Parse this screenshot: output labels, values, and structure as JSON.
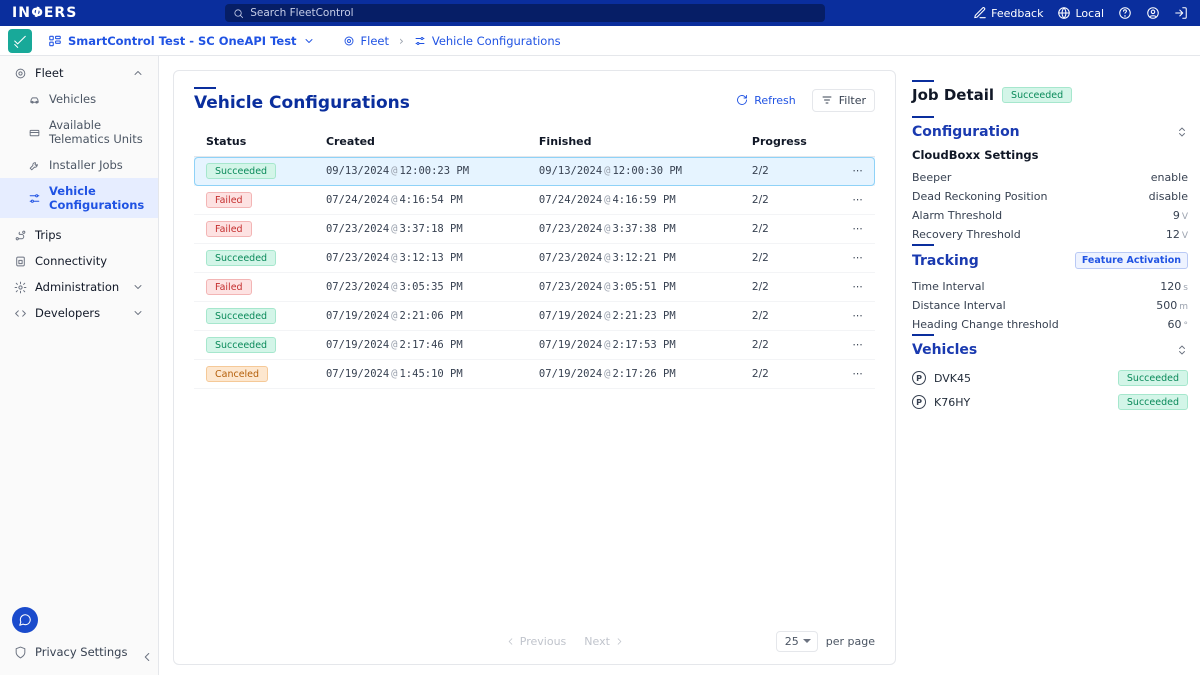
{
  "top": {
    "logo_text": "INVERS",
    "search_placeholder": "Search FleetControl",
    "feedback": "Feedback",
    "locale": "Local"
  },
  "scope": {
    "label": "SmartControl Test - SC OneAPI Test"
  },
  "breadcrumb": {
    "fleet": "Fleet",
    "current": "Vehicle Configurations"
  },
  "sidebar": {
    "fleet": "Fleet",
    "vehicles": "Vehicles",
    "atu": "Available Telematics Units",
    "installer": "Installer Jobs",
    "vconfig": "Vehicle Configurations",
    "trips": "Trips",
    "connectivity": "Connectivity",
    "admin": "Administration",
    "dev": "Developers",
    "privacy": "Privacy Settings"
  },
  "page": {
    "title": "Vehicle Configurations",
    "refresh": "Refresh",
    "filter": "Filter",
    "columns": {
      "status": "Status",
      "created": "Created",
      "finished": "Finished",
      "progress": "Progress"
    },
    "pagination": {
      "previous": "Previous",
      "next": "Next",
      "page_size": "25",
      "per_page": "per page"
    }
  },
  "jobs": [
    {
      "status": "Succeeded",
      "created_d": "09/13/2024",
      "created_t": "12:00:23 PM",
      "finished_d": "09/13/2024",
      "finished_t": "12:00:30 PM",
      "progress": "2/2",
      "selected": true
    },
    {
      "status": "Failed",
      "created_d": "07/24/2024",
      "created_t": "4:16:54 PM",
      "finished_d": "07/24/2024",
      "finished_t": "4:16:59 PM",
      "progress": "2/2"
    },
    {
      "status": "Failed",
      "created_d": "07/23/2024",
      "created_t": "3:37:18 PM",
      "finished_d": "07/23/2024",
      "finished_t": "3:37:38 PM",
      "progress": "2/2"
    },
    {
      "status": "Succeeded",
      "created_d": "07/23/2024",
      "created_t": "3:12:13 PM",
      "finished_d": "07/23/2024",
      "finished_t": "3:12:21 PM",
      "progress": "2/2"
    },
    {
      "status": "Failed",
      "created_d": "07/23/2024",
      "created_t": "3:05:35 PM",
      "finished_d": "07/23/2024",
      "finished_t": "3:05:51 PM",
      "progress": "2/2"
    },
    {
      "status": "Succeeded",
      "created_d": "07/19/2024",
      "created_t": "2:21:06 PM",
      "finished_d": "07/19/2024",
      "finished_t": "2:21:23 PM",
      "progress": "2/2"
    },
    {
      "status": "Succeeded",
      "created_d": "07/19/2024",
      "created_t": "2:17:46 PM",
      "finished_d": "07/19/2024",
      "finished_t": "2:17:53 PM",
      "progress": "2/2"
    },
    {
      "status": "Canceled",
      "created_d": "07/19/2024",
      "created_t": "1:45:10 PM",
      "finished_d": "07/19/2024",
      "finished_t": "2:17:26 PM",
      "progress": "2/2"
    }
  ],
  "detail": {
    "heading": "Job Detail",
    "status": "Succeeded",
    "config": "Configuration",
    "cloudboxx": "CloudBoxx Settings",
    "settings": [
      {
        "k": "Beeper",
        "v": "enable"
      },
      {
        "k": "Dead Reckoning Position",
        "v": "disable"
      },
      {
        "k": "Alarm Threshold",
        "v": "9",
        "u": "V"
      },
      {
        "k": "Recovery Threshold",
        "v": "12",
        "u": "V"
      }
    ],
    "tracking": "Tracking",
    "feature_label": "Feature Activation",
    "tracking_settings": [
      {
        "k": "Time Interval",
        "v": "120",
        "u": "s"
      },
      {
        "k": "Distance Interval",
        "v": "500",
        "u": "m"
      },
      {
        "k": "Heading Change threshold",
        "v": "60",
        "u": "°"
      }
    ],
    "vehicles_heading": "Vehicles",
    "vehicles": [
      {
        "name": "DVK45",
        "status": "Succeeded"
      },
      {
        "name": "K76HY",
        "status": "Succeeded"
      }
    ]
  }
}
